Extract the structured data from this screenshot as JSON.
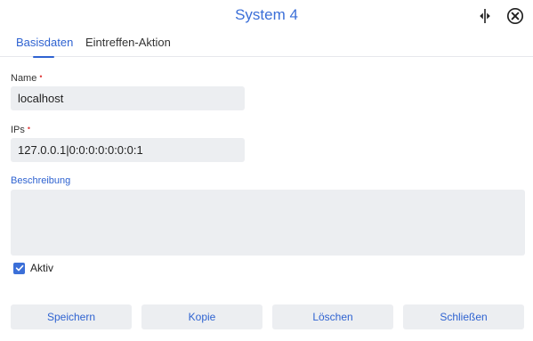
{
  "dialog": {
    "title": "System 4",
    "tabs": [
      {
        "label": "Basisdaten",
        "active": true
      },
      {
        "label": "Eintreffen-Aktion",
        "active": false
      }
    ]
  },
  "form": {
    "name": {
      "label": "Name",
      "required_mark": "•",
      "value": "localhost"
    },
    "ips": {
      "label": "IPs",
      "required_mark": "•",
      "value": "127.0.0.1|0:0:0:0:0:0:0:1"
    },
    "description": {
      "label": "Beschreibung",
      "value": ""
    },
    "active": {
      "label": "Aktiv",
      "checked": true
    }
  },
  "buttons": {
    "save": "Speichern",
    "copy": "Kopie",
    "delete": "Löschen",
    "close": "Schließen"
  },
  "colors": {
    "accent": "#3b6fd8",
    "field_bg": "#eceef1",
    "required": "#e04040"
  },
  "icons": {
    "split": "split-view-icon",
    "close": "close-circle-icon"
  }
}
